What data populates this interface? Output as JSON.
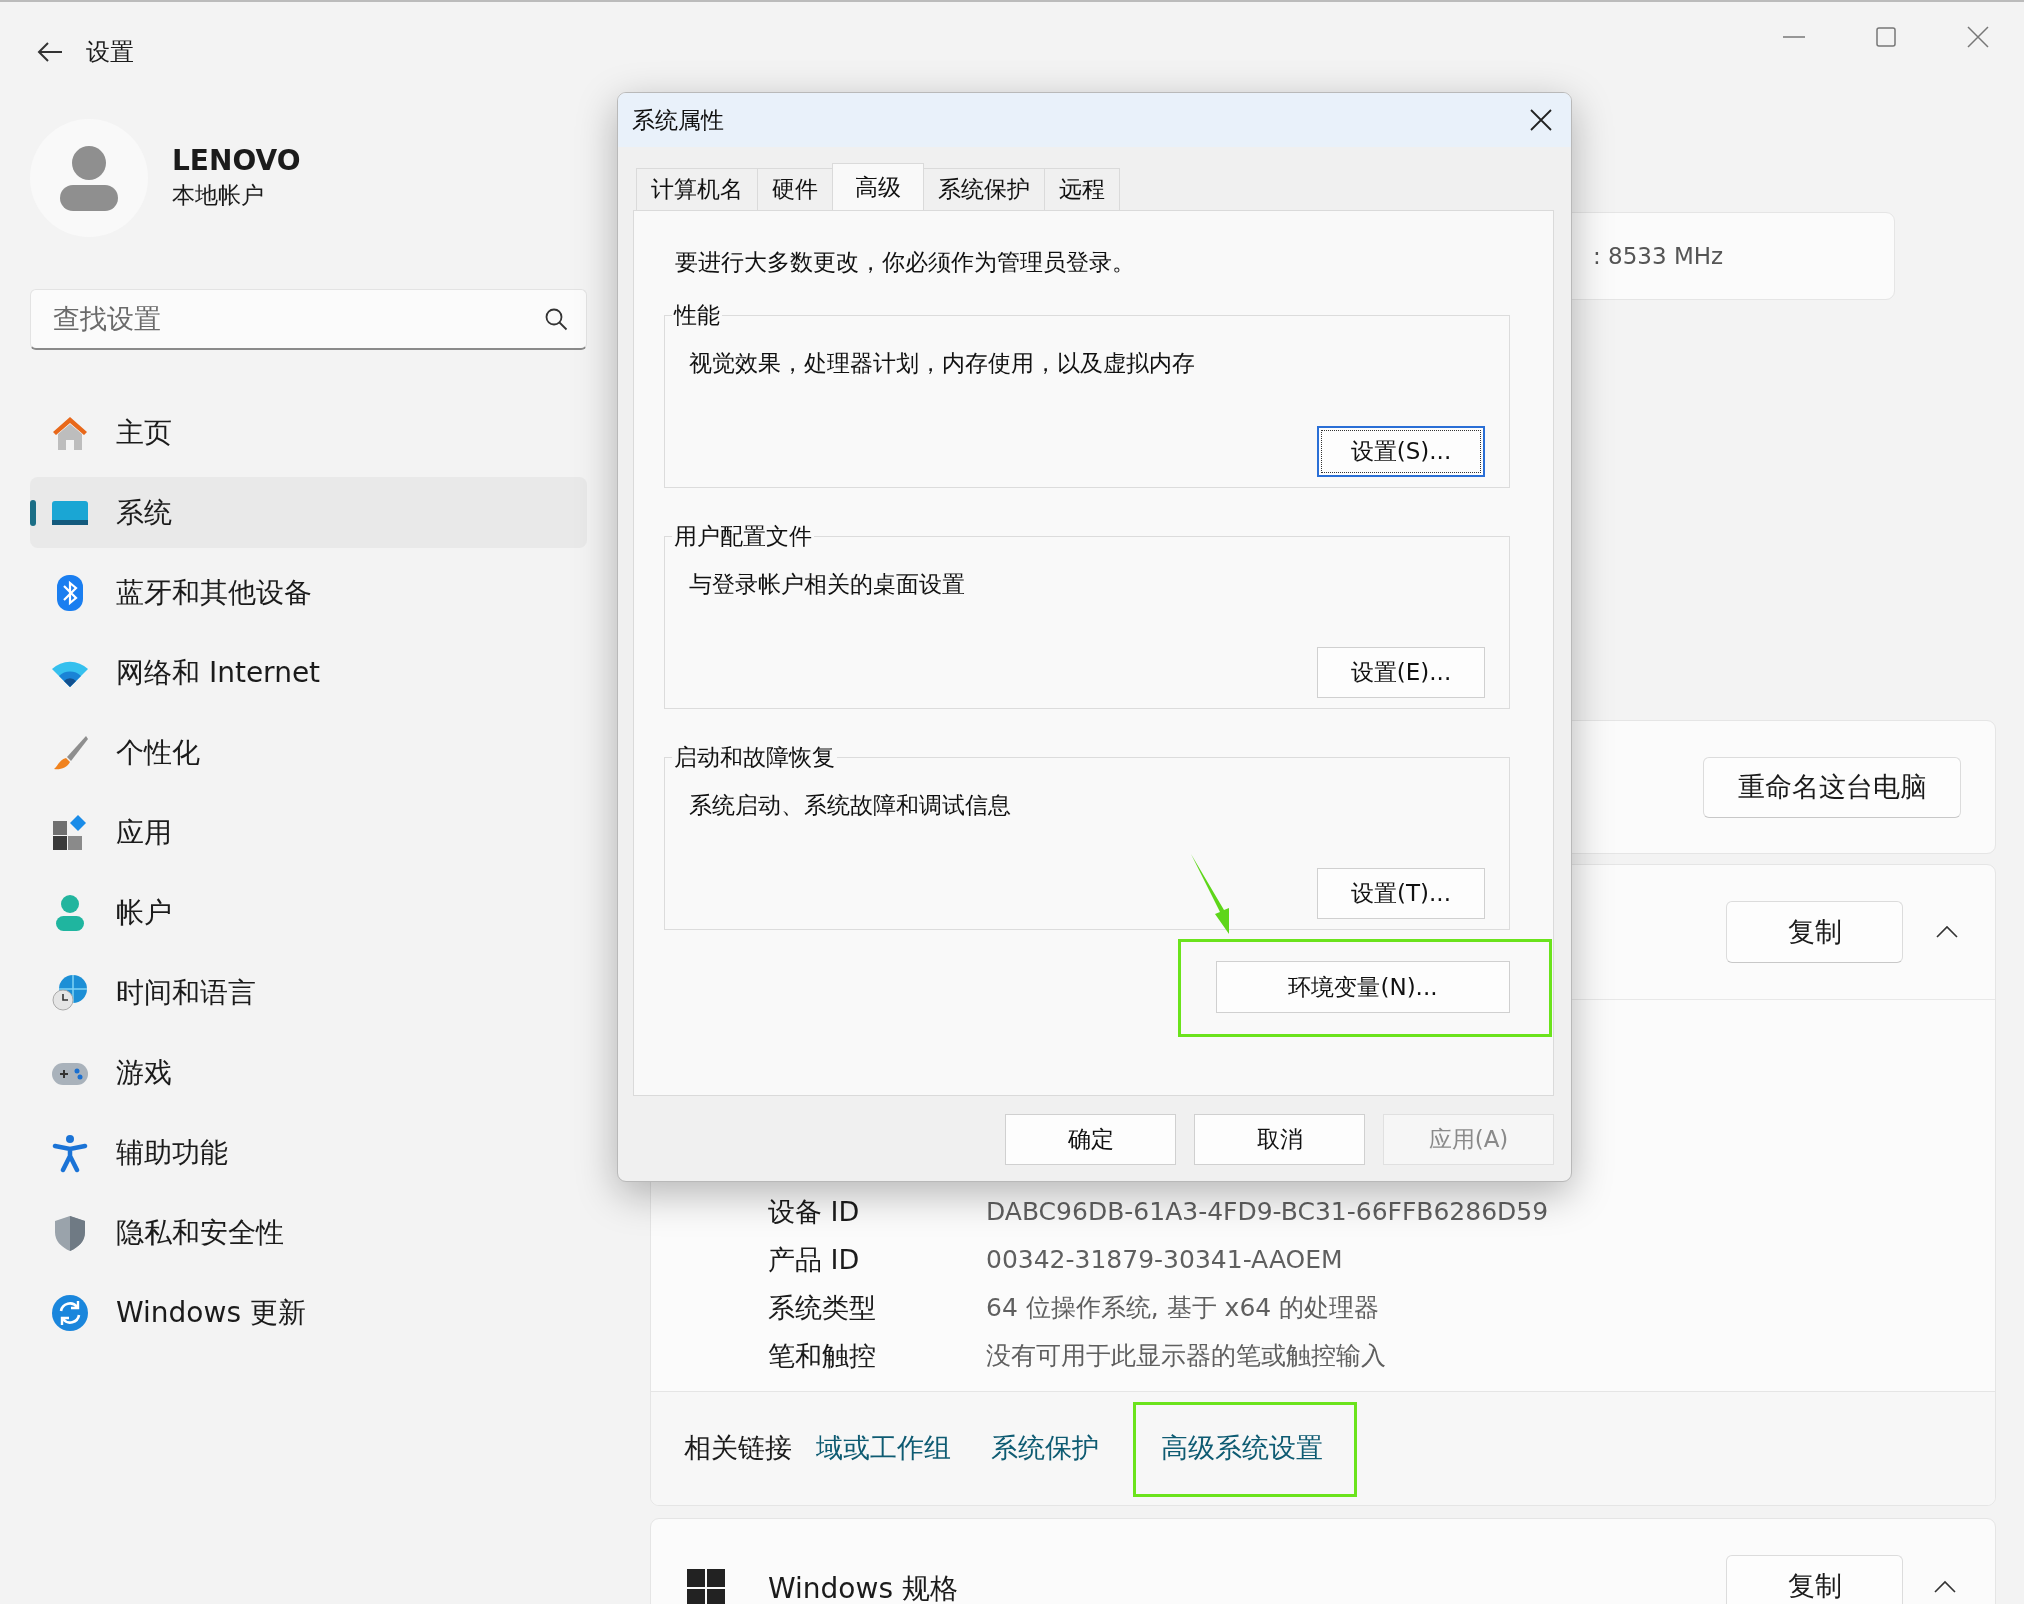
{
  "window": {
    "title": "设置"
  },
  "account": {
    "name": "LENOVO",
    "type": "本地帐户"
  },
  "search": {
    "placeholder": "查找设置"
  },
  "nav": [
    {
      "label": "主页",
      "selected": false
    },
    {
      "label": "系统",
      "selected": true
    },
    {
      "label": "蓝牙和其他设备",
      "selected": false
    },
    {
      "label": "网络和 Internet",
      "selected": false
    },
    {
      "label": "个性化",
      "selected": false
    },
    {
      "label": "应用",
      "selected": false
    },
    {
      "label": "帐户",
      "selected": false
    },
    {
      "label": "时间和语言",
      "selected": false
    },
    {
      "label": "游戏",
      "selected": false
    },
    {
      "label": "辅助功能",
      "selected": false
    },
    {
      "label": "隐私和安全性",
      "selected": false
    },
    {
      "label": "Windows 更新",
      "selected": false
    }
  ],
  "spec_card": {
    "text": ": 8533 MHz"
  },
  "rename_button": "重命名这台电脑",
  "device_spec": {
    "copy_button": "复制",
    "expanded": true,
    "rows": [
      {
        "label": "设备 ID",
        "value": "DABC96DB-61A3-4FD9-BC31-66FFB6286D59"
      },
      {
        "label": "产品 ID",
        "value": "00342-31879-30341-AAOEM"
      },
      {
        "label": "系统类型",
        "value": "64 位操作系统, 基于 x64 的处理器"
      },
      {
        "label": "笔和触控",
        "value": "没有可用于此显示器的笔或触控输入"
      }
    ]
  },
  "related_links": {
    "label": "相关链接",
    "links": [
      {
        "text": "域或工作组",
        "highlighted": false
      },
      {
        "text": "系统保护",
        "highlighted": false
      },
      {
        "text": "高级系统设置",
        "highlighted": true
      }
    ]
  },
  "windows_spec": {
    "title": "Windows 规格",
    "copy_button": "复制",
    "expanded": true
  },
  "dialog": {
    "title": "系统属性",
    "tabs": [
      {
        "label": "计算机名",
        "selected": false
      },
      {
        "label": "硬件",
        "selected": false
      },
      {
        "label": "高级",
        "selected": true
      },
      {
        "label": "系统保护",
        "selected": false
      },
      {
        "label": "远程",
        "selected": false
      }
    ],
    "notice": "要进行大多数更改，你必须作为管理员登录。",
    "groups": [
      {
        "title": "性能",
        "description": "视觉效果，处理器计划，内存使用，以及虚拟内存",
        "button": "设置(S)...",
        "focused": true
      },
      {
        "title": "用户配置文件",
        "description": "与登录帐户相关的桌面设置",
        "button": "设置(E)...",
        "focused": false
      },
      {
        "title": "启动和故障恢复",
        "description": "系统启动、系统故障和调试信息",
        "button": "设置(T)...",
        "focused": false
      }
    ],
    "env_button": {
      "label": "环境变量(N)...",
      "highlighted": true
    },
    "buttons": [
      {
        "label": "确定",
        "disabled": false
      },
      {
        "label": "取消",
        "disabled": false
      },
      {
        "label": "应用(A)",
        "disabled": true
      }
    ]
  }
}
